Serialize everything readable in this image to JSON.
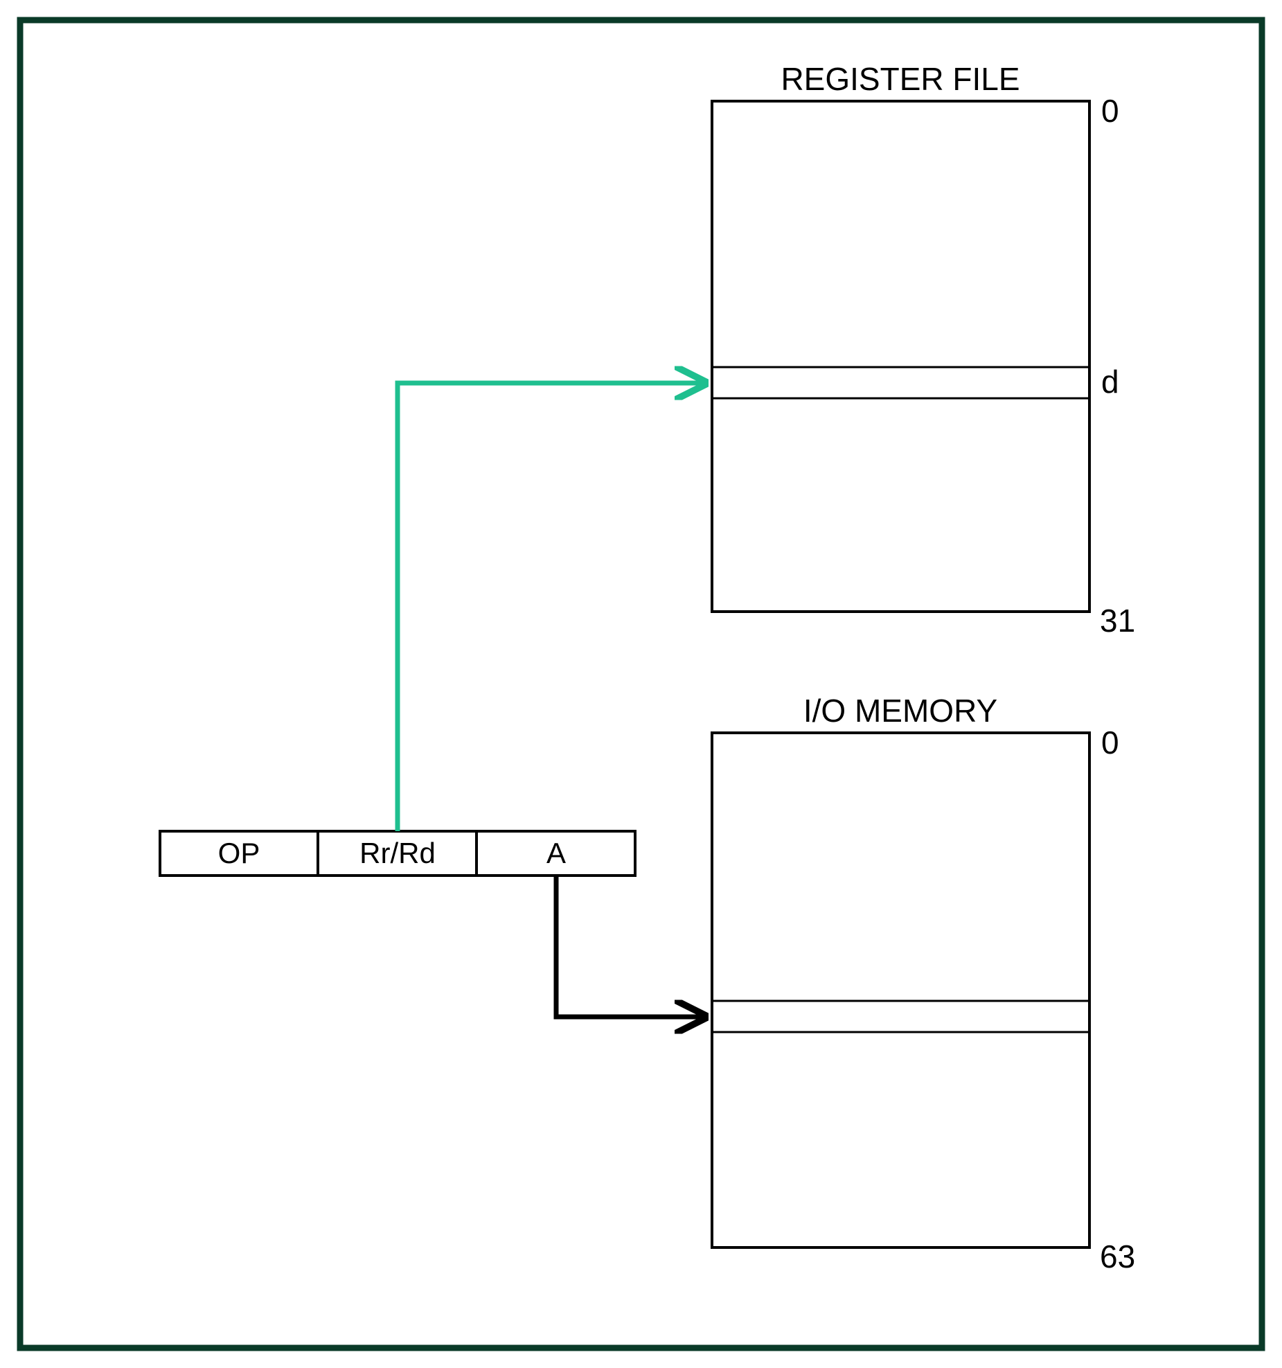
{
  "register_file": {
    "title": "REGISTER FILE",
    "top_index": "0",
    "bottom_index": "31",
    "slot_label": "d"
  },
  "io_memory": {
    "title": "I/O MEMORY",
    "top_index": "0",
    "bottom_index": "63"
  },
  "instruction": {
    "op": "OP",
    "reg": "Rr/Rd",
    "addr": "A"
  },
  "colors": {
    "border": "#0a3a28",
    "arrow_green": "#1fbf8f",
    "arrow_black": "#000000"
  }
}
